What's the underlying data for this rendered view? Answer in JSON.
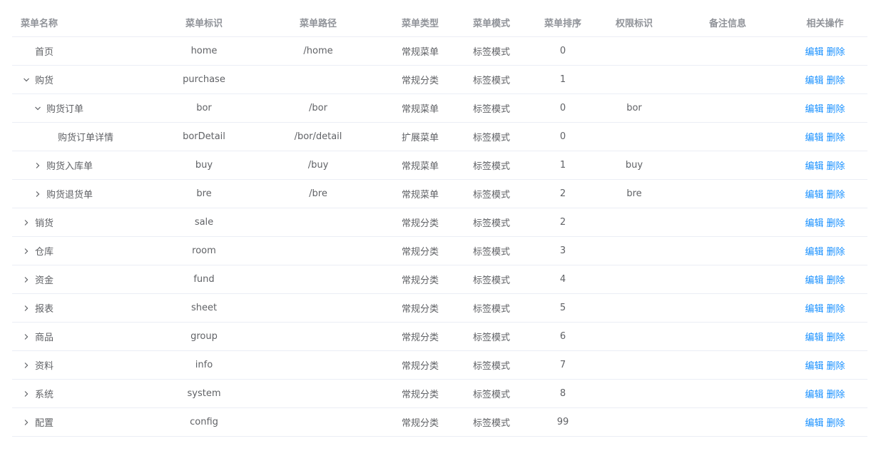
{
  "headers": {
    "name": "菜单名称",
    "ident": "菜单标识",
    "path": "菜单路径",
    "type": "菜单类型",
    "mode": "菜单模式",
    "sort": "菜单排序",
    "perm": "权限标识",
    "remark": "备注信息",
    "ops": "相关操作"
  },
  "actions": {
    "edit": "编辑",
    "delete": "删除"
  },
  "colors": {
    "link": "#1890ff",
    "text": "#606266",
    "header": "#909399",
    "border": "#ebeef5"
  },
  "rows": [
    {
      "level": 0,
      "toggle": "none",
      "name": "首页",
      "ident": "home",
      "path": "/home",
      "type": "常规菜单",
      "mode": "标签模式",
      "sort": "0",
      "perm": "",
      "remark": ""
    },
    {
      "level": 0,
      "toggle": "expanded",
      "name": "购货",
      "ident": "purchase",
      "path": "",
      "type": "常规分类",
      "mode": "标签模式",
      "sort": "1",
      "perm": "",
      "remark": ""
    },
    {
      "level": 1,
      "toggle": "expanded",
      "name": "购货订单",
      "ident": "bor",
      "path": "/bor",
      "type": "常规菜单",
      "mode": "标签模式",
      "sort": "0",
      "perm": "bor",
      "remark": ""
    },
    {
      "level": 2,
      "toggle": "none",
      "name": "购货订单详情",
      "ident": "borDetail",
      "path": "/bor/detail",
      "type": "扩展菜单",
      "mode": "标签模式",
      "sort": "0",
      "perm": "",
      "remark": ""
    },
    {
      "level": 1,
      "toggle": "collapsed",
      "name": "购货入库单",
      "ident": "buy",
      "path": "/buy",
      "type": "常规菜单",
      "mode": "标签模式",
      "sort": "1",
      "perm": "buy",
      "remark": ""
    },
    {
      "level": 1,
      "toggle": "collapsed",
      "name": "购货退货单",
      "ident": "bre",
      "path": "/bre",
      "type": "常规菜单",
      "mode": "标签模式",
      "sort": "2",
      "perm": "bre",
      "remark": ""
    },
    {
      "level": 0,
      "toggle": "collapsed",
      "name": "销货",
      "ident": "sale",
      "path": "",
      "type": "常规分类",
      "mode": "标签模式",
      "sort": "2",
      "perm": "",
      "remark": ""
    },
    {
      "level": 0,
      "toggle": "collapsed",
      "name": "仓库",
      "ident": "room",
      "path": "",
      "type": "常规分类",
      "mode": "标签模式",
      "sort": "3",
      "perm": "",
      "remark": ""
    },
    {
      "level": 0,
      "toggle": "collapsed",
      "name": "资金",
      "ident": "fund",
      "path": "",
      "type": "常规分类",
      "mode": "标签模式",
      "sort": "4",
      "perm": "",
      "remark": ""
    },
    {
      "level": 0,
      "toggle": "collapsed",
      "name": "报表",
      "ident": "sheet",
      "path": "",
      "type": "常规分类",
      "mode": "标签模式",
      "sort": "5",
      "perm": "",
      "remark": ""
    },
    {
      "level": 0,
      "toggle": "collapsed",
      "name": "商品",
      "ident": "group",
      "path": "",
      "type": "常规分类",
      "mode": "标签模式",
      "sort": "6",
      "perm": "",
      "remark": ""
    },
    {
      "level": 0,
      "toggle": "collapsed",
      "name": "资料",
      "ident": "info",
      "path": "",
      "type": "常规分类",
      "mode": "标签模式",
      "sort": "7",
      "perm": "",
      "remark": ""
    },
    {
      "level": 0,
      "toggle": "collapsed",
      "name": "系统",
      "ident": "system",
      "path": "",
      "type": "常规分类",
      "mode": "标签模式",
      "sort": "8",
      "perm": "",
      "remark": ""
    },
    {
      "level": 0,
      "toggle": "collapsed",
      "name": "配置",
      "ident": "config",
      "path": "",
      "type": "常规分类",
      "mode": "标签模式",
      "sort": "99",
      "perm": "",
      "remark": ""
    }
  ]
}
